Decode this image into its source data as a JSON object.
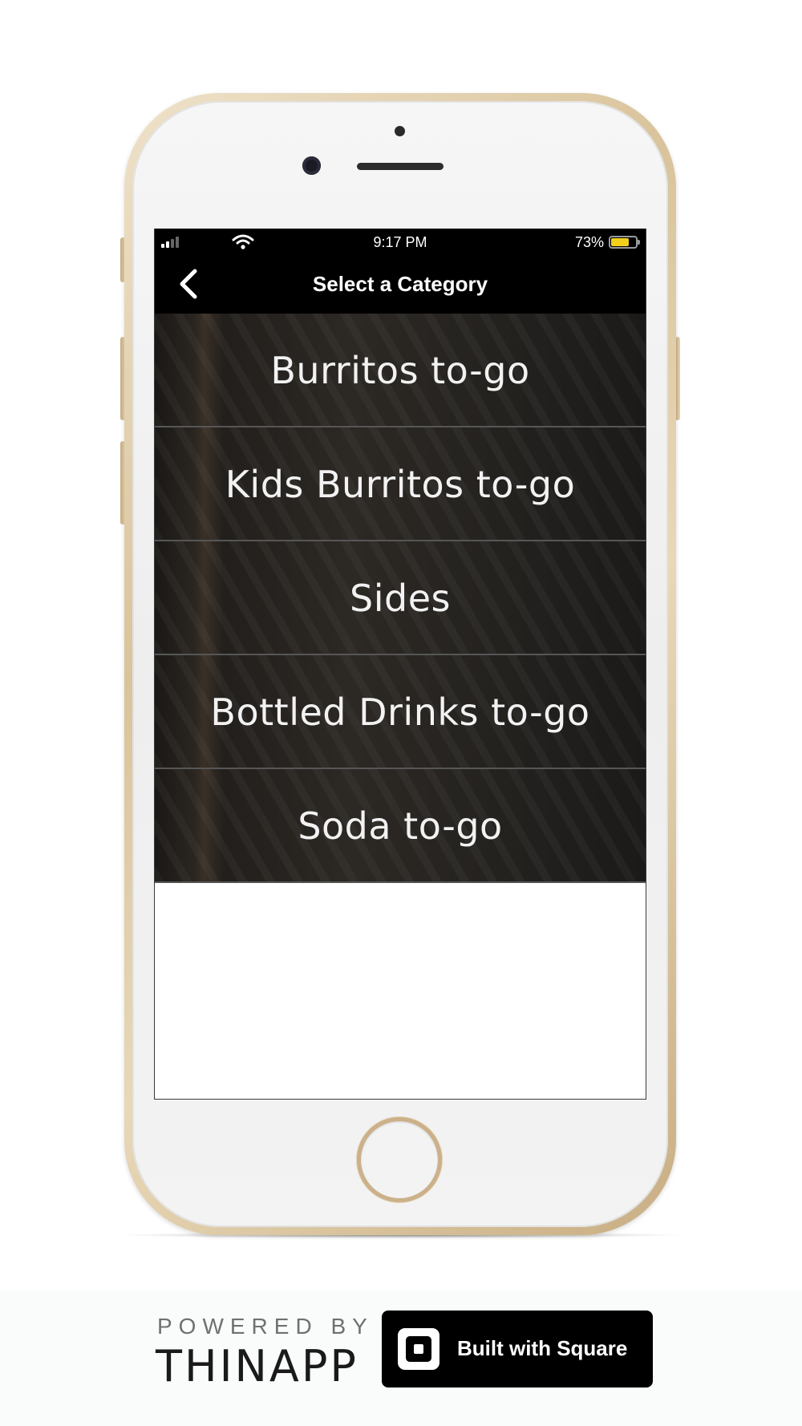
{
  "status_bar": {
    "time": "9:17 PM",
    "battery_percent_text": "73%",
    "battery_level": 0.73,
    "signal_bars": 2,
    "icons": [
      "cellular-signal-icon",
      "wifi-icon",
      "battery-icon"
    ]
  },
  "nav": {
    "title": "Select a Category",
    "back_icon": "chevron-left-icon"
  },
  "categories": [
    {
      "label": "Burritos to-go"
    },
    {
      "label": "Kids Burritos to-go"
    },
    {
      "label": "Sides"
    },
    {
      "label": "Bottled Drinks to-go"
    },
    {
      "label": "Soda to-go"
    }
  ],
  "footer": {
    "powered_by": "POWERED BY",
    "brand": "THINAPP",
    "square_button_label": "Built with Square",
    "square_icon": "square-logo-icon"
  },
  "colors": {
    "battery_fill": "#f2cf1b",
    "nav_background": "#000000",
    "phone_gold": "#d9c39b"
  }
}
